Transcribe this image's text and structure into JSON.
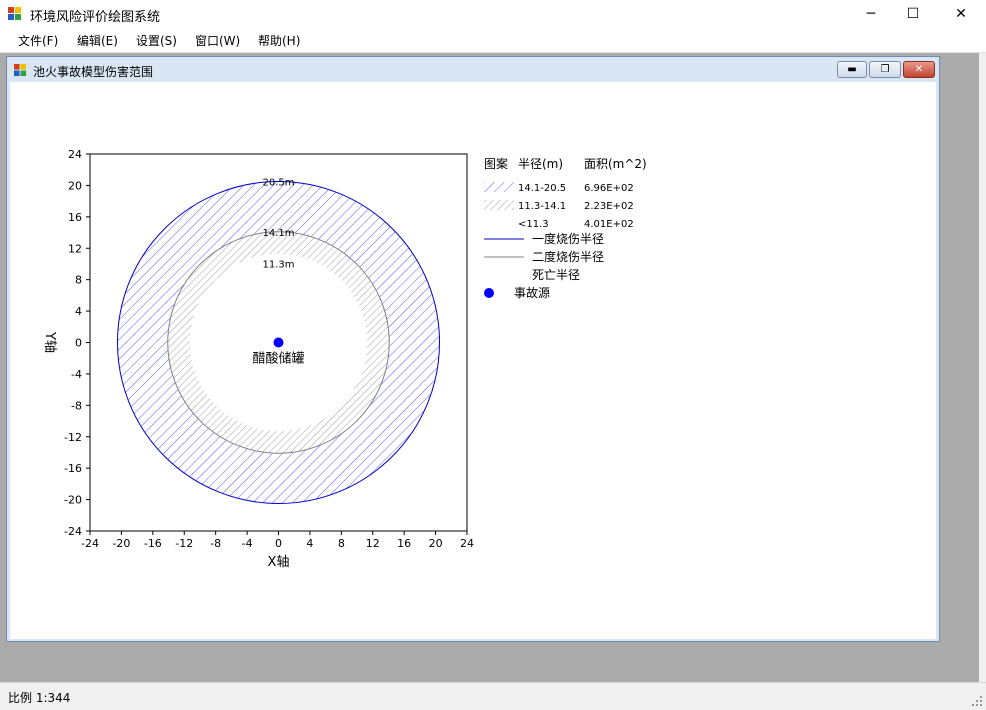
{
  "window": {
    "title": "环境风险评价绘图系统",
    "min": "─",
    "max": "☐",
    "close": "✕"
  },
  "menu": [
    "文件(F)",
    "编辑(E)",
    "设置(S)",
    "窗口(W)",
    "帮助(H)"
  ],
  "child_window": {
    "title": "池火事故模型伤害范围",
    "min": "▬",
    "restore": "❐",
    "close": "✕"
  },
  "status": {
    "scale": "比例 1:344"
  },
  "chart_data": {
    "type": "contour",
    "xlabel": "X轴",
    "ylabel": "Y轴",
    "xlim": [
      -24,
      24
    ],
    "ylim": [
      -24,
      24
    ],
    "xticks": [
      -24,
      -20,
      -16,
      -12,
      -8,
      -4,
      0,
      4,
      8,
      12,
      16,
      20,
      24
    ],
    "yticks": [
      24,
      20,
      16,
      12,
      8,
      4,
      0,
      -4,
      -8,
      -12,
      -16,
      -20,
      -24
    ],
    "source": {
      "x": 0,
      "y": 0,
      "label": "醋酸储罐"
    },
    "circles": [
      {
        "name": "一度烧伤半径",
        "radius": 20.5,
        "label": "20.5m",
        "color": "#0000cc"
      },
      {
        "name": "二度烧伤半径",
        "radius": 14.1,
        "label": "14.1m",
        "color": "#808080"
      },
      {
        "name": "死亡半径",
        "radius": 11.3,
        "label": "11.3m",
        "color": "#ffffff"
      }
    ],
    "legend": {
      "headers": [
        "图案",
        "半径(m)",
        "面积(m^2)"
      ],
      "rows": [
        {
          "range": "14.1-20.5",
          "area": "6.96E+02",
          "pattern": "blue-hatch"
        },
        {
          "range": "11.3-14.1",
          "area": "2.23E+02",
          "pattern": "gray-hatch"
        },
        {
          "range": "<11.3",
          "area": "4.01E+02",
          "pattern": "none"
        }
      ],
      "lines": [
        {
          "label": "一度烧伤半径",
          "color": "#0000cc"
        },
        {
          "label": "二度烧伤半径",
          "color": "#808080"
        },
        {
          "label": "死亡半径",
          "color": "#ffffff"
        }
      ],
      "marker": {
        "label": "事故源",
        "color": "#0000ff"
      }
    }
  }
}
